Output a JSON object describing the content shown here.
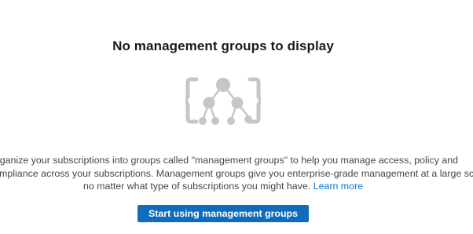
{
  "empty_state": {
    "title": "No management groups to display",
    "illustration_icon": "management-group-hierarchy-icon",
    "description_line1": "Organize your subscriptions into groups called \"management groups\" to help you manage access, policy and",
    "description_line2": "compliance across your subscriptions. Management groups give you enterprise-grade management at a large scale",
    "description_line3": "no matter what type of subscriptions you might have.",
    "learn_more_label": "Learn more",
    "primary_button_label": "Start using management groups"
  },
  "colors": {
    "accent": "#0f6cbd",
    "link": "#0078d4",
    "illustration": "#c8c6c4"
  }
}
